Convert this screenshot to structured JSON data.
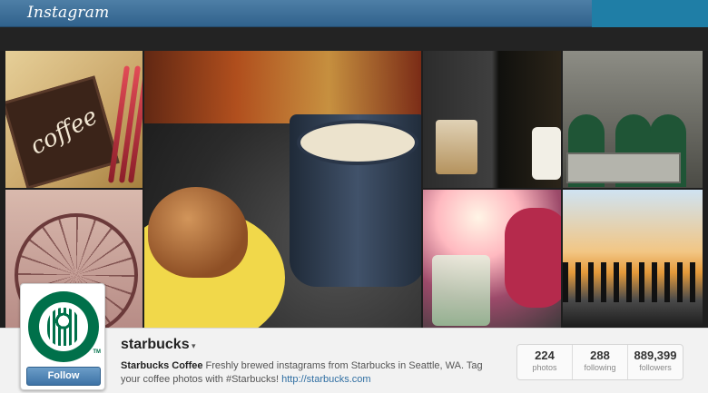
{
  "header": {
    "logo_text": "Instagram"
  },
  "profile": {
    "username": "starbucks",
    "caret_icon": "chevron-down-icon",
    "display_name": "Starbucks Coffee",
    "bio": " Freshly brewed instagrams from Starbucks in Seattle, WA. Tag your coffee photos with #Starbucks! ",
    "link": "http://starbucks.com",
    "follow_label": "Follow",
    "avatar_icon": "starbucks-siren-logo",
    "avatar_tm": "TM"
  },
  "photo_text": {
    "coffee_word": "coffee"
  },
  "stats": [
    {
      "value": "224",
      "label": "photos"
    },
    {
      "value": "288",
      "label": "following"
    },
    {
      "value": "889,399",
      "label": "followers"
    }
  ],
  "colors": {
    "topbar": "#3f719b",
    "follow_button": "#4a7fb0",
    "link": "#2f6ea2",
    "starbucks_green": "#00704a"
  }
}
